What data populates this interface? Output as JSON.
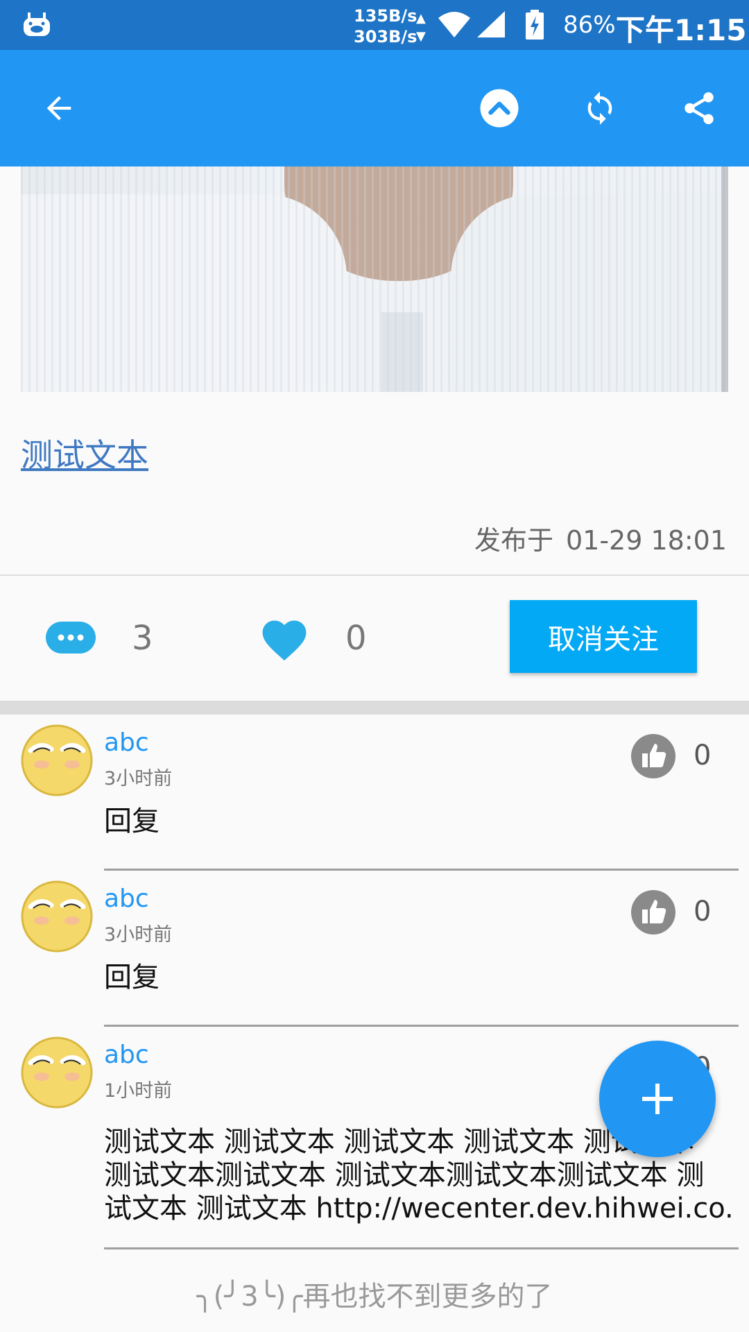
{
  "status_bar": {
    "net_up": "135B/s",
    "net_down": "303B/s",
    "battery": "86%",
    "time": "下午1:15"
  },
  "app_bar": {
    "icons": [
      "arrow-back-icon",
      "chevron-up-circle-icon",
      "refresh-icon",
      "share-icon"
    ]
  },
  "article": {
    "link_text": "测试文本",
    "published_label": "发布于",
    "published_date": "01-29 18:01"
  },
  "actions": {
    "comment_count": "3",
    "like_count": "0",
    "unfollow_label": "取消关注"
  },
  "comments": [
    {
      "user": "abc",
      "time": "3小时前",
      "likes": "0",
      "body": "回复"
    },
    {
      "user": "abc",
      "time": "3小时前",
      "likes": "0",
      "body": "回复"
    },
    {
      "user": "abc",
      "time": "1小时前",
      "likes": "0",
      "body_lines": [
        "测试文本 测试文本 测试文本 测试文本 测试文本",
        "测试文本测试文本 测试文本测试文本测试文本 测",
        "试文本 测试文本 http://wecenter.dev.hihwei.co..."
      ]
    }
  ],
  "footer": {
    "end_message": "╮(╯3╰)╭再也找不到更多的了"
  },
  "colors": {
    "status_bar": "#1e74c6",
    "app_bar": "#2196f3",
    "unfollow_button": "#03a9f4",
    "link": "#3f79c2"
  }
}
